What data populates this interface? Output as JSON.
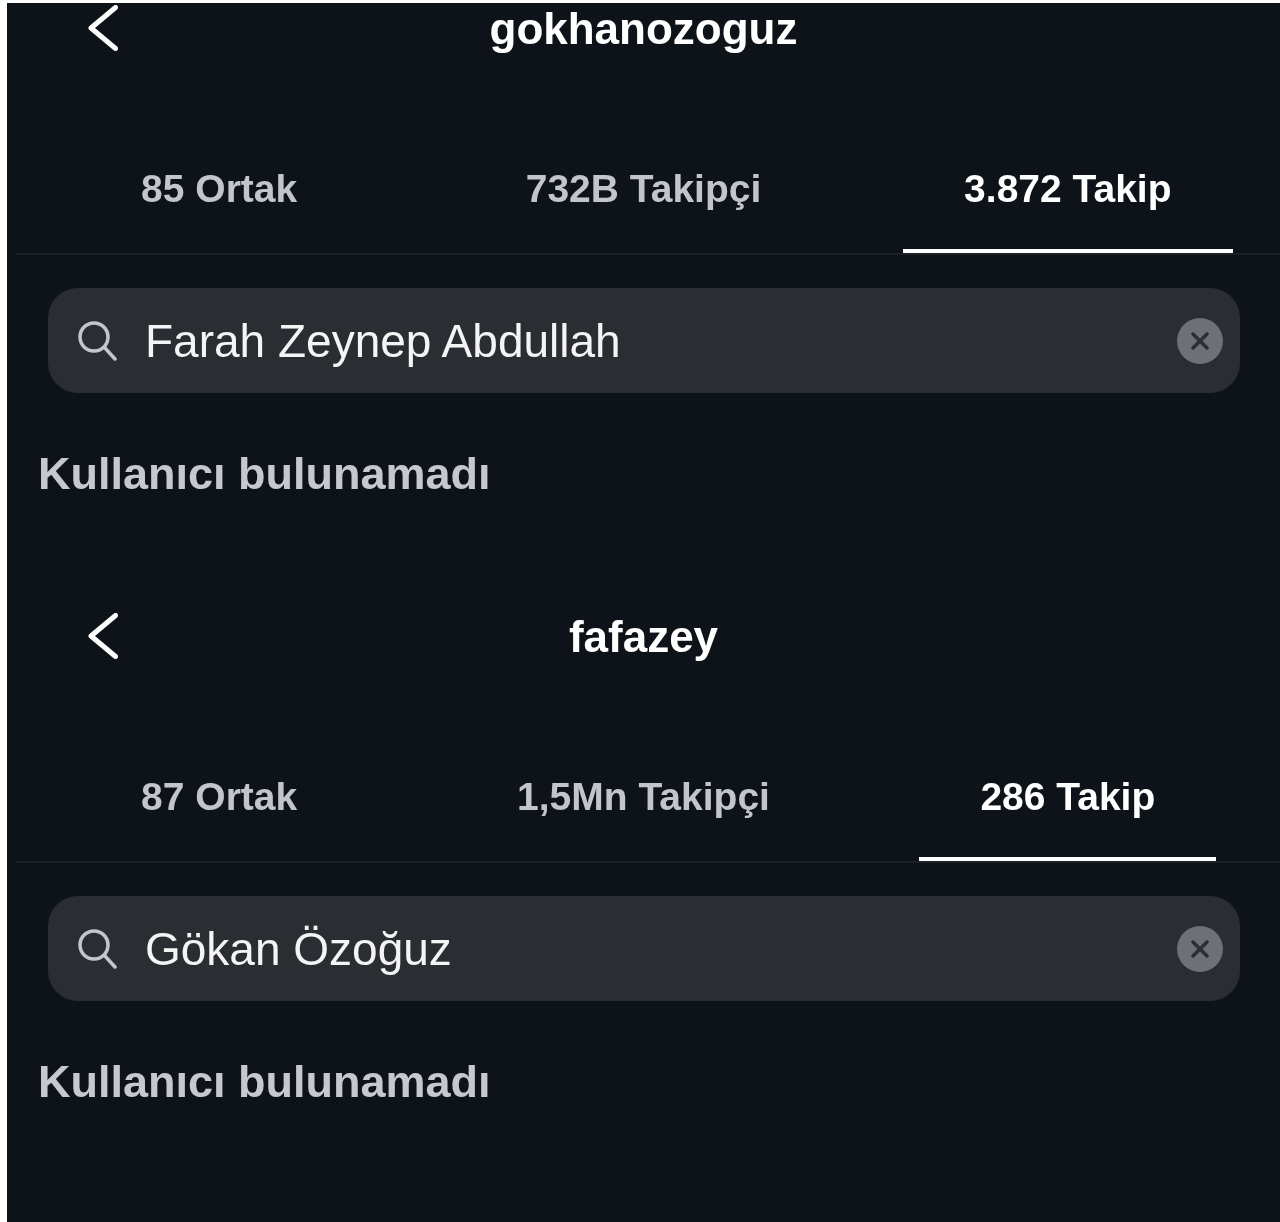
{
  "profiles": [
    {
      "title": "gokhanozoguz",
      "tabs": [
        {
          "label": "85 Ortak",
          "selected": false
        },
        {
          "label": "732B Takipçi",
          "selected": false
        },
        {
          "label": "3.872 Takip",
          "selected": true
        }
      ],
      "search": {
        "value": "Farah Zeynep Abdullah"
      },
      "empty_message": "Kullanıcı bulunamadı"
    },
    {
      "title": "fafazey",
      "tabs": [
        {
          "label": "87 Ortak",
          "selected": false
        },
        {
          "label": "1,5Mn Takipçi",
          "selected": false
        },
        {
          "label": "286 Takip",
          "selected": true
        }
      ],
      "search": {
        "value": "Gökan Özoğuz"
      },
      "empty_message": "Kullanıcı bulunamadı"
    }
  ]
}
